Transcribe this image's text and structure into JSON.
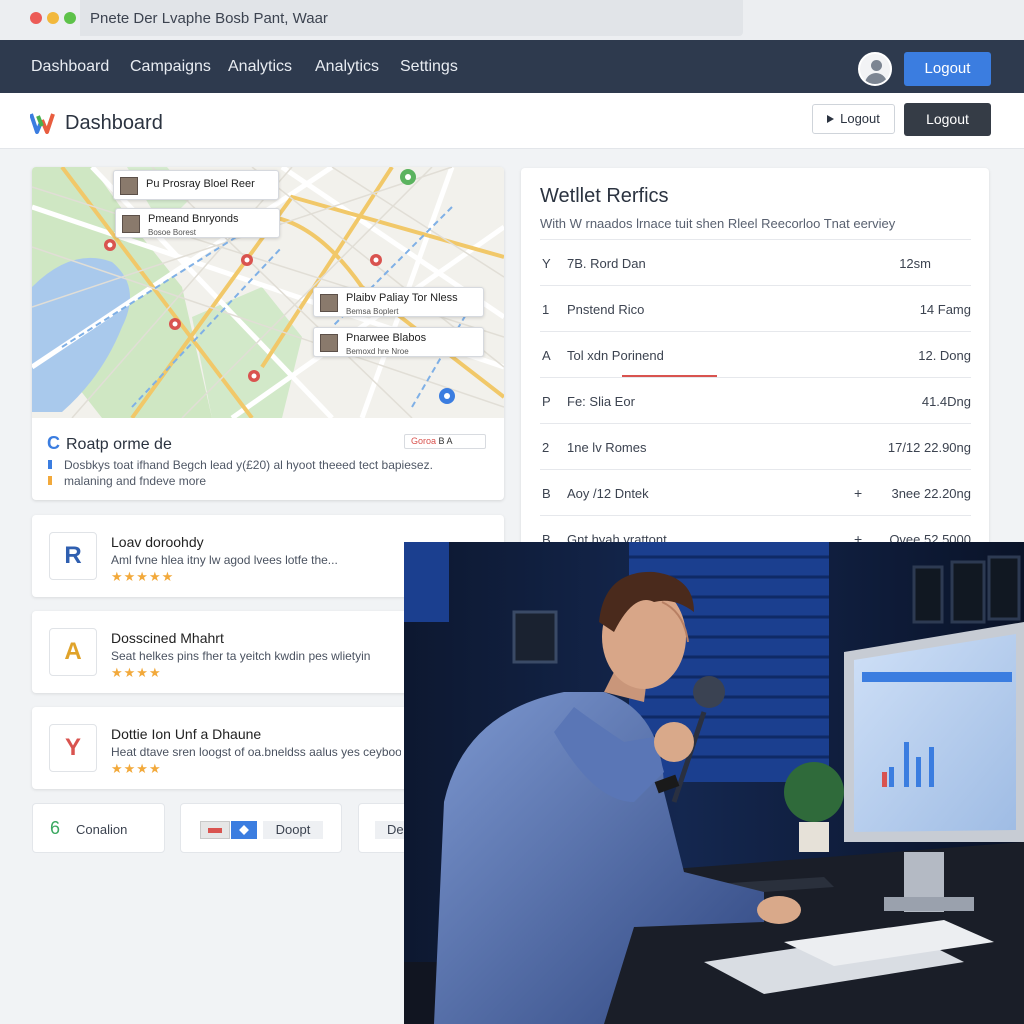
{
  "browser": {
    "address": "Pnete Der Lvaphe Bosb Pant, Waar"
  },
  "nav": {
    "items": [
      "Dashboard",
      "Campaigns",
      "Analytics",
      "Analytics",
      "Settings"
    ],
    "logout": "Logout"
  },
  "header": {
    "title": "Dashboard",
    "logout_outline": "Logout",
    "logout_dark": "Logout"
  },
  "map_card": {
    "labels": [
      {
        "title": "Pu Prosray Bloel Reer",
        "sub": ""
      },
      {
        "title": "Pmeand Bnryonds",
        "sub": "Bosoe Borest"
      },
      {
        "title": "Plaibv Paliay Tor Nless",
        "sub": "Bemsa Boplert"
      },
      {
        "title": "Pnarwee Blabos",
        "sub": "Bemoxd hre Nroe"
      }
    ],
    "info_title": "Roatp orme de",
    "pill_prefix": "Goroa",
    "pill_text": "B A",
    "desc_line1": "Dosbkys toat ifhand Begch lead y(£20) al hyoot theeed tect bapiesez.",
    "desc_line2": "malaning and fndeve more"
  },
  "reviews": [
    {
      "logo": "R",
      "title": "Loav doroohdy",
      "text": "Aml fvne hlea itny lw agod lvees lotfe the...",
      "stars": "★★★★★"
    },
    {
      "logo": "A",
      "title": "Dosscined Mhahrt",
      "text": "Seat helkes pins fher ta yeitch kwdin pes wlietyin",
      "stars": "★★★★"
    },
    {
      "logo": "Y",
      "title": "Dottie Ion Unf a Dhaune",
      "text": "Heat dtave sren loogst of oa.bneldss aalus yes ceyboo",
      "stars": "★★★★"
    }
  ],
  "bottom_buttons": {
    "condition_num": "6",
    "condition_label": "Conalion",
    "doopt_label": "Doopt",
    "de_label": "De"
  },
  "metrics": {
    "title": "Wetllet Rerfics",
    "subtitle": "With W rnaados lrnace tuit shen Rleel Reecorloo Tnat eerviey",
    "rows": [
      {
        "key": "Y",
        "label": "7B. Rord Dan",
        "plus": "",
        "value": "12sm"
      },
      {
        "key": "1",
        "label": "Pnstend Rico",
        "plus": "",
        "value": "14 Famg"
      },
      {
        "key": "A",
        "label": "Tol xdn Porinend",
        "plus": "",
        "value": "12. Dong"
      },
      {
        "key": "P",
        "label": "Fe: Slia Eor",
        "plus": "",
        "value": "41.4Dng"
      },
      {
        "key": "2",
        "label": "1ne lv Romes",
        "plus": "",
        "value": "17/12 22.90ng"
      },
      {
        "key": "B",
        "label": "Aoy /12 Dntek",
        "plus": "+",
        "value": "3nee 22.20ng"
      },
      {
        "key": "B",
        "label": "Gnt hyah vrattont",
        "plus": "+",
        "value": "Ovee 52.5000"
      }
    ]
  },
  "colors": {
    "nav_bg": "#2e3a4e",
    "accent_blue": "#3b7de0",
    "dark_button": "#353c46",
    "star": "#f2a93b",
    "alert_red": "#d9534f"
  }
}
